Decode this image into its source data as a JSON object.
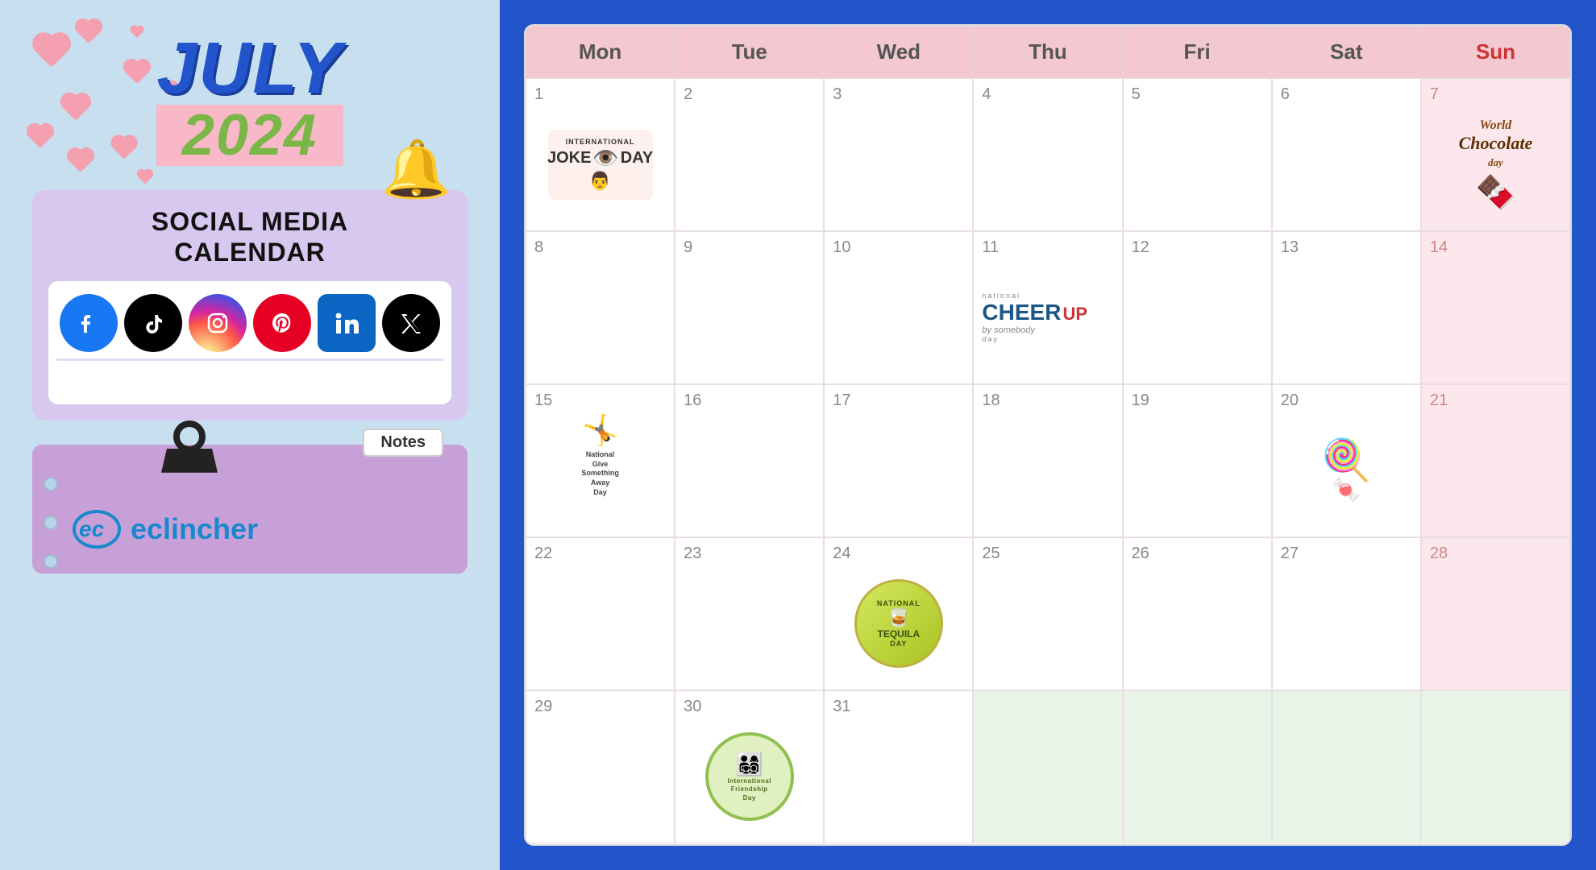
{
  "left": {
    "month": "JULY",
    "year": "2024",
    "social_card_title": "SOCIAL MEDIA\nCALENDAR",
    "social_icons": [
      {
        "name": "Facebook",
        "class": "fb",
        "symbol": "f"
      },
      {
        "name": "TikTok",
        "class": "tiktok",
        "symbol": "♪"
      },
      {
        "name": "Instagram",
        "class": "insta",
        "symbol": "◎"
      },
      {
        "name": "Pinterest",
        "class": "pinterest",
        "symbol": "P"
      },
      {
        "name": "LinkedIn",
        "class": "linkedin",
        "symbol": "in"
      },
      {
        "name": "X (Twitter)",
        "class": "twitter-x",
        "symbol": "✕"
      }
    ],
    "notes_label": "Notes",
    "brand_name": "eclincher"
  },
  "calendar": {
    "headers": [
      "Mon",
      "Tue",
      "Wed",
      "Thu",
      "Fri",
      "Sat",
      "Sun"
    ],
    "weeks": [
      {
        "days": [
          {
            "num": "1",
            "event": "international_joke_day",
            "isSun": false
          },
          {
            "num": "2",
            "event": null,
            "isSun": false
          },
          {
            "num": "3",
            "event": null,
            "isSun": false
          },
          {
            "num": "4",
            "event": null,
            "isSun": false
          },
          {
            "num": "5",
            "event": null,
            "isSun": false
          },
          {
            "num": "6",
            "event": null,
            "isSun": false
          },
          {
            "num": "7",
            "event": "world_chocolate_day",
            "isSun": true
          }
        ]
      },
      {
        "days": [
          {
            "num": "8",
            "event": null,
            "isSun": false
          },
          {
            "num": "9",
            "event": null,
            "isSun": false
          },
          {
            "num": "10",
            "event": null,
            "isSun": false
          },
          {
            "num": "11",
            "event": "national_cheer_up_day",
            "isSun": false
          },
          {
            "num": "12",
            "event": null,
            "isSun": false
          },
          {
            "num": "13",
            "event": null,
            "isSun": false
          },
          {
            "num": "14",
            "event": null,
            "isSun": true
          }
        ]
      },
      {
        "days": [
          {
            "num": "15",
            "event": "give_something_away_day",
            "isSun": false
          },
          {
            "num": "16",
            "event": null,
            "isSun": false
          },
          {
            "num": "17",
            "event": null,
            "isSun": false
          },
          {
            "num": "18",
            "event": null,
            "isSun": false
          },
          {
            "num": "19",
            "event": null,
            "isSun": false
          },
          {
            "num": "20",
            "event": "lollipop_day",
            "isSun": false
          },
          {
            "num": "21",
            "event": null,
            "isSun": true
          }
        ]
      },
      {
        "days": [
          {
            "num": "22",
            "event": null,
            "isSun": false
          },
          {
            "num": "23",
            "event": null,
            "isSun": false
          },
          {
            "num": "24",
            "event": "national_tequila_day",
            "isSun": false
          },
          {
            "num": "25",
            "event": null,
            "isSun": false
          },
          {
            "num": "26",
            "event": null,
            "isSun": false
          },
          {
            "num": "27",
            "event": null,
            "isSun": false
          },
          {
            "num": "28",
            "event": null,
            "isSun": true
          }
        ]
      },
      {
        "days": [
          {
            "num": "29",
            "event": null,
            "isSun": false
          },
          {
            "num": "30",
            "event": "international_friendship_day",
            "isSun": false
          },
          {
            "num": "31",
            "event": null,
            "isSun": false
          },
          {
            "num": "",
            "event": null,
            "isSun": false,
            "isEmpty": true
          },
          {
            "num": "",
            "event": null,
            "isSun": false,
            "isEmpty": true
          },
          {
            "num": "",
            "event": null,
            "isSun": false,
            "isEmpty": true
          },
          {
            "num": "",
            "event": null,
            "isSun": true,
            "isEmpty": true
          }
        ]
      }
    ],
    "events": {
      "international_joke_day": "INTERNATIONAL JOKE DAY",
      "world_chocolate_day": "World Chocolate Day",
      "national_cheer_up_day": "National Cheer Up Somebody Day",
      "give_something_away_day": "National Give Something Away Day",
      "lollipop_day": "Lollipop Day",
      "national_tequila_day": "National Tequila Day",
      "international_friendship_day": "International Friendship Day"
    }
  }
}
